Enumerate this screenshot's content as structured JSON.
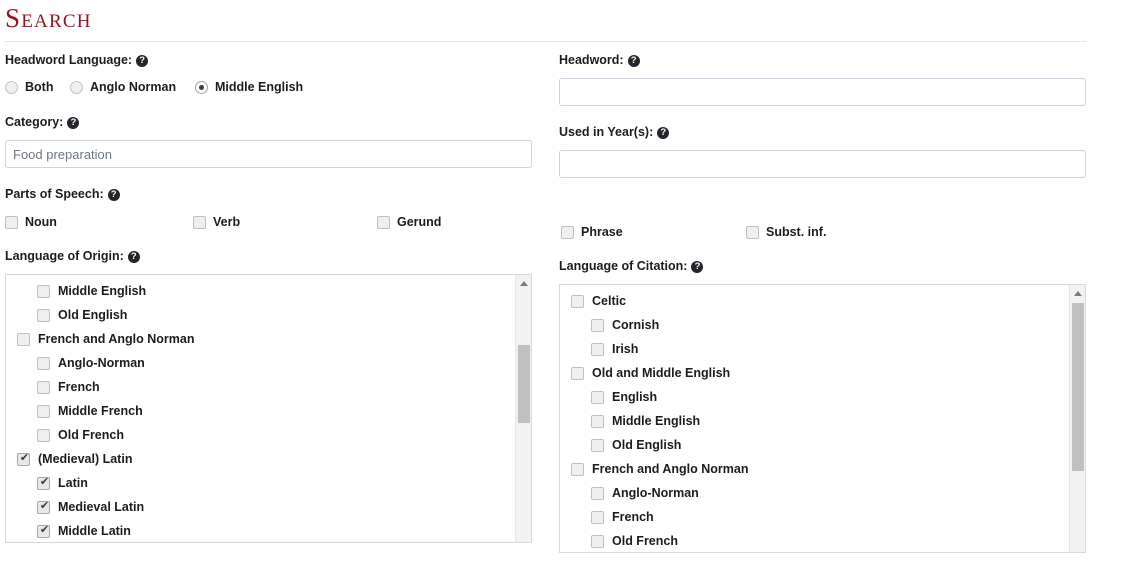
{
  "page": {
    "title": "Search",
    "accent_color": "#9b1220",
    "help_icon_glyph": "?"
  },
  "left_column": {
    "headword_language": {
      "label": "Headword Language:",
      "options": [
        {
          "label": "Both",
          "checked": false
        },
        {
          "label": "Anglo Norman",
          "checked": false
        },
        {
          "label": "Middle English",
          "checked": true
        }
      ]
    },
    "category": {
      "label": "Category:",
      "value": "Food preparation",
      "placeholder": "Food preparation"
    },
    "parts_of_speech": {
      "label": "Parts of Speech:",
      "options": [
        {
          "label": "Noun",
          "checked": false
        },
        {
          "label": "Verb",
          "checked": false
        },
        {
          "label": "Gerund",
          "checked": false
        }
      ]
    },
    "language_of_origin": {
      "label": "Language of Origin:",
      "scroll_position": "middle",
      "items": [
        {
          "label": "Middle English",
          "level": 1,
          "checked": false
        },
        {
          "label": "Old English",
          "level": 1,
          "checked": false
        },
        {
          "label": "French and Anglo Norman",
          "level": 0,
          "checked": false
        },
        {
          "label": "Anglo-Norman",
          "level": 1,
          "checked": false
        },
        {
          "label": "French",
          "level": 1,
          "checked": false
        },
        {
          "label": "Middle French",
          "level": 1,
          "checked": false
        },
        {
          "label": "Old French",
          "level": 1,
          "checked": false
        },
        {
          "label": "(Medieval) Latin",
          "level": 0,
          "checked": true
        },
        {
          "label": "Latin",
          "level": 1,
          "checked": true
        },
        {
          "label": "Medieval Latin",
          "level": 1,
          "checked": true
        },
        {
          "label": "Middle Latin",
          "level": 1,
          "checked": true
        },
        {
          "label": "",
          "level": 0,
          "checked": false
        }
      ]
    }
  },
  "right_column": {
    "headword": {
      "label": "Headword:",
      "value": "",
      "placeholder": ""
    },
    "used_in_years": {
      "label": "Used in Year(s):",
      "value": "",
      "placeholder": ""
    },
    "parts_of_speech": {
      "options": [
        {
          "label": "Phrase",
          "checked": false
        },
        {
          "label": "Subst. inf.",
          "checked": false
        }
      ]
    },
    "language_of_citation": {
      "label": "Language of Citation:",
      "scroll_position": "top",
      "items": [
        {
          "label": "Celtic",
          "level": 0,
          "checked": false
        },
        {
          "label": "Cornish",
          "level": 1,
          "checked": false
        },
        {
          "label": "Irish",
          "level": 1,
          "checked": false
        },
        {
          "label": "Old and Middle English",
          "level": 0,
          "checked": false
        },
        {
          "label": "English",
          "level": 1,
          "checked": false
        },
        {
          "label": "Middle English",
          "level": 1,
          "checked": false
        },
        {
          "label": "Old English",
          "level": 1,
          "checked": false
        },
        {
          "label": "French and Anglo Norman",
          "level": 0,
          "checked": false
        },
        {
          "label": "Anglo-Norman",
          "level": 1,
          "checked": false
        },
        {
          "label": "French",
          "level": 1,
          "checked": false
        },
        {
          "label": "Old French",
          "level": 1,
          "checked": false
        }
      ]
    }
  }
}
